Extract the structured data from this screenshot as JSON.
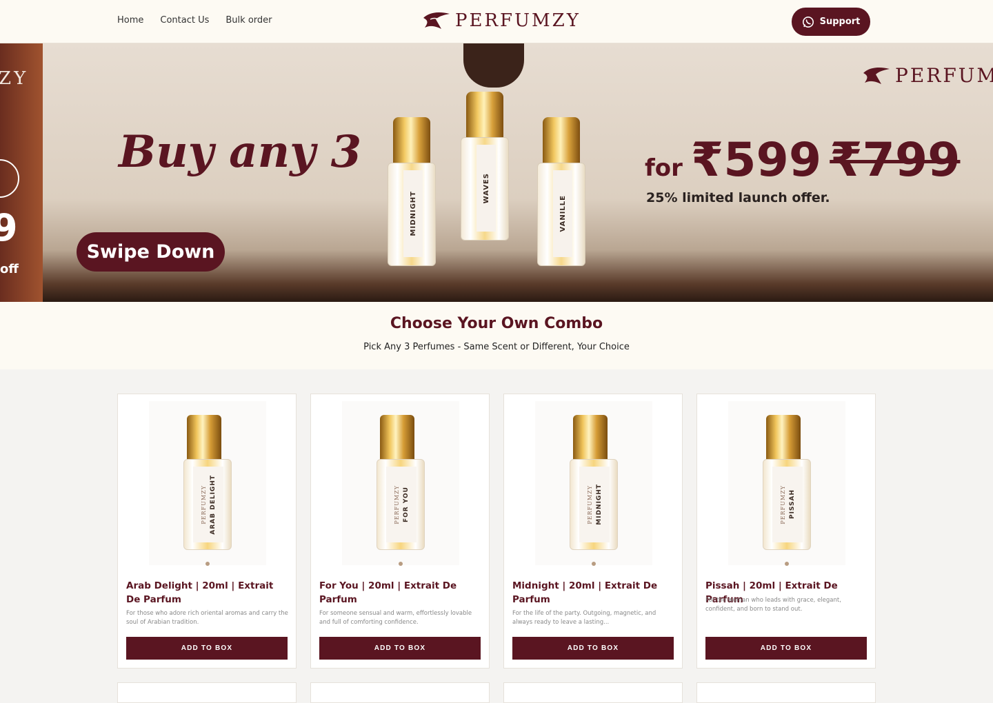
{
  "nav": {
    "home": "Home",
    "contact": "Contact Us",
    "bulk": "Bulk order"
  },
  "brand": {
    "name": "PERFUMZY"
  },
  "support": {
    "label": "Support",
    "icon": "whatsapp-icon"
  },
  "hero": {
    "prev_slide": {
      "brand_fragment": "ZY",
      "price_fragment": "9",
      "off_text": "off"
    },
    "headline": "Buy any 3",
    "swipe_label": "Swipe Down",
    "price_for": "for",
    "price_new": "₹599",
    "price_old": "₹799",
    "offer": "25% limited launch offer.",
    "bottles": [
      "MIDNIGHT",
      "WAVES",
      "VANILLE"
    ]
  },
  "combo": {
    "title": "Choose Your Own Combo",
    "subtitle": "Pick Any 3 Perfumes - Same Scent or Different, Your Choice"
  },
  "products": [
    {
      "scent": "ARAB DELIGHT",
      "title": "Arab Delight | 20ml | Extrait De Parfum",
      "desc": "For those who adore rich oriental aromas and carry the soul of Arabian tradition.",
      "button": "ADD TO BOX"
    },
    {
      "scent": "FOR YOU",
      "title": "For You | 20ml | Extrait De Parfum",
      "desc": "For someone sensual and warm, effortlessly lovable and full of comforting confidence.",
      "button": "ADD TO BOX"
    },
    {
      "scent": "MIDNIGHT",
      "title": "Midnight | 20ml | Extrait De Parfum",
      "desc": "For the life of the party. Outgoing, magnetic, and always ready to leave a lasting...",
      "button": "ADD TO BOX"
    },
    {
      "scent": "PISSAH",
      "title": "Pissah | 20ml | Extrait De Parfum",
      "desc": "For the woman who leads with grace, elegant, confident, and born to stand out.",
      "button": "ADD TO BOX"
    }
  ],
  "colors": {
    "brand": "#5a1521",
    "header_bg": "#fdfaf3",
    "page_bg": "#f4f3f1"
  }
}
